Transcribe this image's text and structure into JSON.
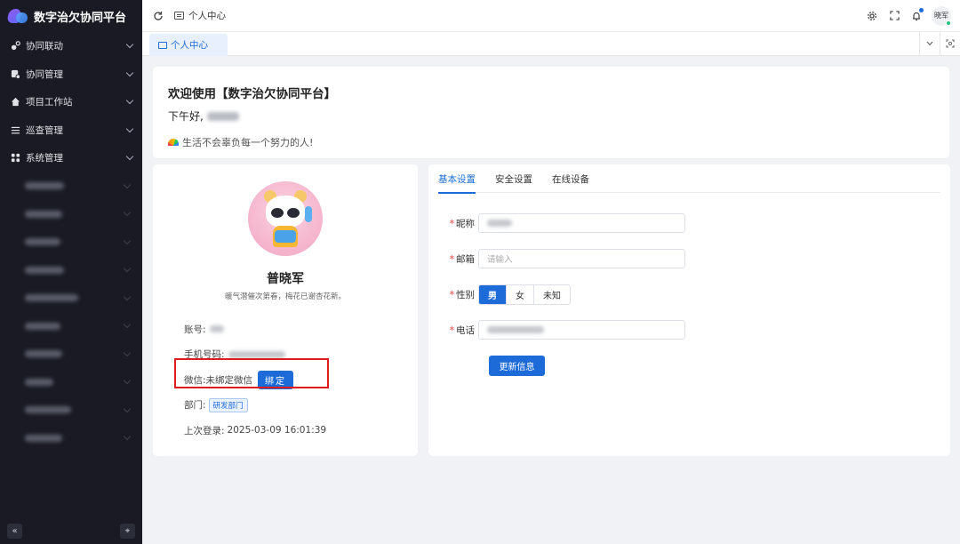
{
  "app": {
    "title": "数字治欠协同平台"
  },
  "sidebar": {
    "items": [
      {
        "label": "协同联动",
        "icon": "link-icon"
      },
      {
        "label": "协同管理",
        "icon": "database-icon"
      },
      {
        "label": "项目工作站",
        "icon": "home-icon"
      },
      {
        "label": "巡查管理",
        "icon": "list-icon"
      },
      {
        "label": "系统管理",
        "icon": "grid-icon"
      }
    ],
    "collapse_label": "«",
    "pin_label": "⌖"
  },
  "header": {
    "breadcrumb": "个人中心",
    "avatar_text": "晓军"
  },
  "tabs": {
    "active_label": "个人中心"
  },
  "welcome": {
    "title": "欢迎使用【数字治欠协同平台】",
    "greeting": "下午好,",
    "motto": "生活不会辜负每一个努力的人!"
  },
  "profile": {
    "name": "普晓军",
    "quote": "暖气潜催次第春，梅花已谢杏花新。",
    "account_label": "账号:",
    "phone_label": "手机号码:",
    "wechat_label": "微信:",
    "wechat_value": "未绑定微信",
    "bind_label": "绑定",
    "dept_label": "部门:",
    "dept_value": "研发部门",
    "last_login_label": "上次登录:",
    "last_login_value": "2025-03-09 16:01:39"
  },
  "settings": {
    "tabs": [
      "基本设置",
      "安全设置",
      "在线设备"
    ],
    "nickname_label": "昵称",
    "email_label": "邮箱",
    "email_placeholder": "请输入",
    "gender_label": "性别",
    "gender_options": [
      "男",
      "女",
      "未知"
    ],
    "gender_selected": "男",
    "phone_label": "电话",
    "update_label": "更新信息"
  },
  "colors": {
    "primary": "#1c6bd8",
    "sidebar_bg": "#191a23",
    "highlight": "#e01b1b"
  }
}
